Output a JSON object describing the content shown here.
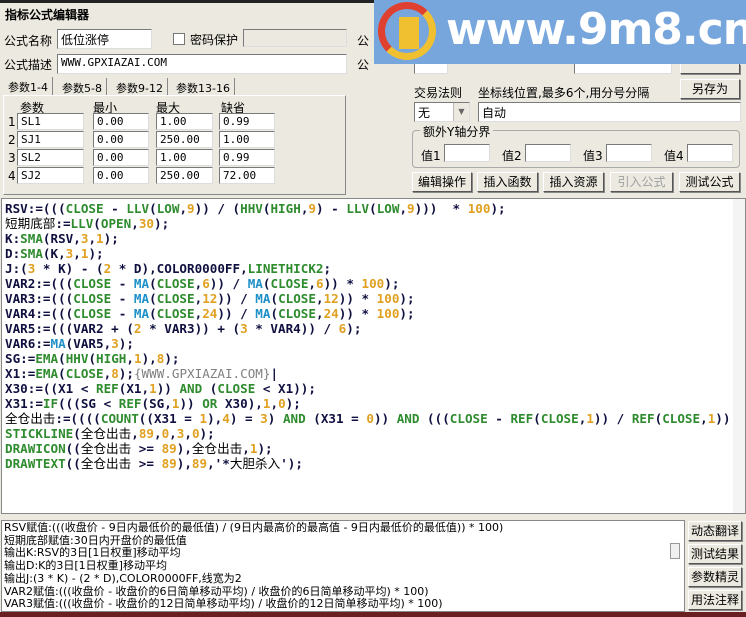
{
  "window": {
    "title": "指标公式编辑器"
  },
  "form": {
    "name_label": "公式名称",
    "name_value": "低位涨停",
    "password_label": "密码保护",
    "password_checked": false,
    "desc_label": "公式描述",
    "desc_value": "WWW.GPXIAZAI.COM",
    "partial_label_1": "公",
    "partial_label_2": "公"
  },
  "tabs": [
    {
      "label": "参数1-4",
      "active": true
    },
    {
      "label": "参数5-8"
    },
    {
      "label": "参数9-12"
    },
    {
      "label": "参数13-16"
    }
  ],
  "params": {
    "headers": [
      "参数",
      "最小",
      "最大",
      "缺省"
    ],
    "rows": [
      {
        "idx": "1",
        "name": "SL1",
        "min": "0.00",
        "max": "1.00",
        "def": "0.99"
      },
      {
        "idx": "2",
        "name": "SJ1",
        "min": "0.00",
        "max": "250.00",
        "def": "1.00"
      },
      {
        "idx": "3",
        "name": "SL2",
        "min": "0.00",
        "max": "1.00",
        "def": "0.99"
      },
      {
        "idx": "4",
        "name": "SJ2",
        "min": "0.00",
        "max": "250.00",
        "def": "72.00"
      }
    ]
  },
  "right": {
    "save_as": "另存为",
    "trade_rule_label": "交易法则",
    "trade_rule_value": "无",
    "axis_label": "坐标线位置,最多6个,用分号分隔",
    "axis_value": "自动",
    "yaxis_group": "额外Y轴分界",
    "values": [
      {
        "label": "值1",
        "value": ""
      },
      {
        "label": "值2",
        "value": ""
      },
      {
        "label": "值3",
        "value": ""
      },
      {
        "label": "值4",
        "value": ""
      }
    ]
  },
  "toolbar": {
    "edit": "编辑操作",
    "insert_func": "插入函数",
    "insert_res": "插入资源",
    "import": "引入公式",
    "test": "测试公式"
  },
  "watermark": {
    "text": "www.9m8.cn"
  },
  "code_lines": [
    [
      [
        "t",
        "RSV:=((("
      ],
      [
        "f",
        "CLOSE"
      ],
      [
        "t",
        " - "
      ],
      [
        "f",
        "LLV"
      ],
      [
        "t",
        "("
      ],
      [
        "f",
        "LOW"
      ],
      [
        "t",
        ","
      ],
      [
        "n",
        "9"
      ],
      [
        "t",
        ")) / ("
      ],
      [
        "f",
        "HHV"
      ],
      [
        "t",
        "("
      ],
      [
        "f",
        "HIGH"
      ],
      [
        "t",
        ","
      ],
      [
        "n",
        "9"
      ],
      [
        "t",
        ") - "
      ],
      [
        "f",
        "LLV"
      ],
      [
        "t",
        "("
      ],
      [
        "f",
        "LOW"
      ],
      [
        "t",
        ","
      ],
      [
        "n",
        "9"
      ],
      [
        "t",
        ")))  * "
      ],
      [
        "n",
        "100"
      ],
      [
        "t",
        ");"
      ]
    ],
    [
      [
        "cn",
        "短期底部"
      ],
      [
        "t",
        ":="
      ],
      [
        "f",
        "LLV"
      ],
      [
        "t",
        "("
      ],
      [
        "f",
        "OPEN"
      ],
      [
        "t",
        ","
      ],
      [
        "n",
        "30"
      ],
      [
        "t",
        ");"
      ]
    ],
    [
      [
        "t",
        "K:"
      ],
      [
        "f",
        "SMA"
      ],
      [
        "t",
        "(RSV,"
      ],
      [
        "n",
        "3"
      ],
      [
        "t",
        ","
      ],
      [
        "n",
        "1"
      ],
      [
        "t",
        ");"
      ]
    ],
    [
      [
        "t",
        "D:"
      ],
      [
        "f",
        "SMA"
      ],
      [
        "t",
        "(K,"
      ],
      [
        "n",
        "3"
      ],
      [
        "t",
        ","
      ],
      [
        "n",
        "1"
      ],
      [
        "t",
        ");"
      ]
    ],
    [
      [
        "t",
        "J:("
      ],
      [
        "n",
        "3"
      ],
      [
        "t",
        " * K) - ("
      ],
      [
        "n",
        "2"
      ],
      [
        "t",
        " * D),COLOR0000FF,"
      ],
      [
        "f",
        "LINETHICK2"
      ],
      [
        "t",
        ";"
      ]
    ],
    [
      [
        "t",
        "VAR2:=((("
      ],
      [
        "f",
        "CLOSE"
      ],
      [
        "t",
        " - "
      ],
      [
        "m",
        "MA"
      ],
      [
        "t",
        "("
      ],
      [
        "f",
        "CLOSE"
      ],
      [
        "t",
        ","
      ],
      [
        "n",
        "6"
      ],
      [
        "t",
        ")) / "
      ],
      [
        "m",
        "MA"
      ],
      [
        "t",
        "("
      ],
      [
        "f",
        "CLOSE"
      ],
      [
        "t",
        ","
      ],
      [
        "n",
        "6"
      ],
      [
        "t",
        ")) * "
      ],
      [
        "n",
        "100"
      ],
      [
        "t",
        ");"
      ]
    ],
    [
      [
        "t",
        "VAR3:=((("
      ],
      [
        "f",
        "CLOSE"
      ],
      [
        "t",
        " - "
      ],
      [
        "m",
        "MA"
      ],
      [
        "t",
        "("
      ],
      [
        "f",
        "CLOSE"
      ],
      [
        "t",
        ","
      ],
      [
        "n",
        "12"
      ],
      [
        "t",
        ")) / "
      ],
      [
        "m",
        "MA"
      ],
      [
        "t",
        "("
      ],
      [
        "f",
        "CLOSE"
      ],
      [
        "t",
        ","
      ],
      [
        "n",
        "12"
      ],
      [
        "t",
        ")) * "
      ],
      [
        "n",
        "100"
      ],
      [
        "t",
        ");"
      ]
    ],
    [
      [
        "t",
        "VAR4:=((("
      ],
      [
        "f",
        "CLOSE"
      ],
      [
        "t",
        " - "
      ],
      [
        "m",
        "MA"
      ],
      [
        "t",
        "("
      ],
      [
        "f",
        "CLOSE"
      ],
      [
        "t",
        ","
      ],
      [
        "n",
        "24"
      ],
      [
        "t",
        ")) / "
      ],
      [
        "m",
        "MA"
      ],
      [
        "t",
        "("
      ],
      [
        "f",
        "CLOSE"
      ],
      [
        "t",
        ","
      ],
      [
        "n",
        "24"
      ],
      [
        "t",
        ")) * "
      ],
      [
        "n",
        "100"
      ],
      [
        "t",
        ");"
      ]
    ],
    [
      [
        "t",
        "VAR5:=(((VAR2 + ("
      ],
      [
        "n",
        "2"
      ],
      [
        "t",
        " * VAR3)) + ("
      ],
      [
        "n",
        "3"
      ],
      [
        "t",
        " * VAR4)) / "
      ],
      [
        "n",
        "6"
      ],
      [
        "t",
        ");"
      ]
    ],
    [
      [
        "t",
        "VAR6:="
      ],
      [
        "m",
        "MA"
      ],
      [
        "t",
        "(VAR5,"
      ],
      [
        "n",
        "3"
      ],
      [
        "t",
        ");"
      ]
    ],
    [
      [
        "t",
        "SG:="
      ],
      [
        "f",
        "EMA"
      ],
      [
        "t",
        "("
      ],
      [
        "f",
        "HHV"
      ],
      [
        "t",
        "("
      ],
      [
        "f",
        "HIGH"
      ],
      [
        "t",
        ","
      ],
      [
        "n",
        "1"
      ],
      [
        "t",
        "),"
      ],
      [
        "n",
        "8"
      ],
      [
        "t",
        ");"
      ]
    ],
    [
      [
        "t",
        "X1:="
      ],
      [
        "f",
        "EMA"
      ],
      [
        "t",
        "("
      ],
      [
        "f",
        "CLOSE"
      ],
      [
        "t",
        ","
      ],
      [
        "n",
        "8"
      ],
      [
        "t",
        ");"
      ],
      [
        "c",
        "{WWW.GPXIAZAI.COM}"
      ],
      [
        "t",
        "|"
      ]
    ],
    [
      [
        "t",
        "X30:=((X1 < "
      ],
      [
        "f",
        "REF"
      ],
      [
        "t",
        "(X1,"
      ],
      [
        "n",
        "1"
      ],
      [
        "t",
        ")) "
      ],
      [
        "f",
        "AND"
      ],
      [
        "t",
        " ("
      ],
      [
        "f",
        "CLOSE"
      ],
      [
        "t",
        " < X1));"
      ]
    ],
    [
      [
        "t",
        "X31:="
      ],
      [
        "f",
        "IF"
      ],
      [
        "t",
        "(((SG < "
      ],
      [
        "f",
        "REF"
      ],
      [
        "t",
        "(SG,"
      ],
      [
        "n",
        "1"
      ],
      [
        "t",
        ")) "
      ],
      [
        "f",
        "OR"
      ],
      [
        "t",
        " X30),"
      ],
      [
        "n",
        "1"
      ],
      [
        "t",
        ","
      ],
      [
        "n",
        "0"
      ],
      [
        "t",
        ");"
      ]
    ],
    [
      [
        "cn",
        "全仓出击"
      ],
      [
        "t",
        ":=(((("
      ],
      [
        "f",
        "COUNT"
      ],
      [
        "t",
        "((X31 = "
      ],
      [
        "n",
        "1"
      ],
      [
        "t",
        "),"
      ],
      [
        "n",
        "4"
      ],
      [
        "t",
        ") = "
      ],
      [
        "n",
        "3"
      ],
      [
        "t",
        ") "
      ],
      [
        "f",
        "AND"
      ],
      [
        "t",
        " (X31 = "
      ],
      [
        "n",
        "0"
      ],
      [
        "t",
        ")) "
      ],
      [
        "f",
        "AND"
      ],
      [
        "t",
        " ((("
      ],
      [
        "f",
        "CLOSE"
      ],
      [
        "t",
        " - "
      ],
      [
        "f",
        "REF"
      ],
      [
        "t",
        "("
      ],
      [
        "f",
        "CLOSE"
      ],
      [
        "t",
        ","
      ],
      [
        "n",
        "1"
      ],
      [
        "t",
        ")) / "
      ],
      [
        "f",
        "REF"
      ],
      [
        "t",
        "("
      ],
      [
        "f",
        "CLOSE"
      ],
      [
        "t",
        ","
      ],
      [
        "n",
        "1"
      ],
      [
        "t",
        "))"
      ]
    ],
    [
      [
        "f",
        "STICKLINE"
      ],
      [
        "t",
        "("
      ],
      [
        "cn",
        "全仓出击"
      ],
      [
        "t",
        ","
      ],
      [
        "n",
        "89"
      ],
      [
        "t",
        ","
      ],
      [
        "n",
        "0"
      ],
      [
        "t",
        ","
      ],
      [
        "n",
        "3"
      ],
      [
        "t",
        ","
      ],
      [
        "n",
        "0"
      ],
      [
        "t",
        ");"
      ]
    ],
    [
      [
        "f",
        "DRAWICON"
      ],
      [
        "t",
        "(("
      ],
      [
        "cn",
        "全仓出击"
      ],
      [
        "t",
        " >= "
      ],
      [
        "n",
        "89"
      ],
      [
        "t",
        "),"
      ],
      [
        "cn",
        "全仓出击"
      ],
      [
        "t",
        ","
      ],
      [
        "n",
        "1"
      ],
      [
        "t",
        ");"
      ]
    ],
    [
      [
        "f",
        "DRAWTEXT"
      ],
      [
        "t",
        "(("
      ],
      [
        "cn",
        "全仓出击"
      ],
      [
        "t",
        " >= "
      ],
      [
        "n",
        "89"
      ],
      [
        "t",
        "),"
      ],
      [
        "n",
        "89"
      ],
      [
        "t",
        ",'*"
      ],
      [
        "cn",
        "大胆杀入"
      ],
      [
        "t",
        "');"
      ]
    ]
  ],
  "explain_lines": [
    "RSV赋值:(((收盘价 - 9日内最低价的最低值) / (9日内最高价的最高值 - 9日内最低价的最低值)) * 100)",
    "短期底部赋值:30日内开盘价的最低值",
    "输出K:RSV的3日[1日权重]移动平均",
    "输出D:K的3日[1日权重]移动平均",
    "输出J:(3 * K) - (2 * D),COLOR0000FF,线宽为2",
    "VAR2赋值:(((收盘价 - 收盘价的6日简单移动平均) / 收盘价的6日简单移动平均) * 100)",
    "VAR3赋值:(((收盘价 - 收盘价的12日简单移动平均) / 收盘价的12日简单移动平均) * 100)"
  ],
  "side_buttons": [
    "动态翻译",
    "测试结果",
    "参数精灵",
    "用法注释"
  ]
}
